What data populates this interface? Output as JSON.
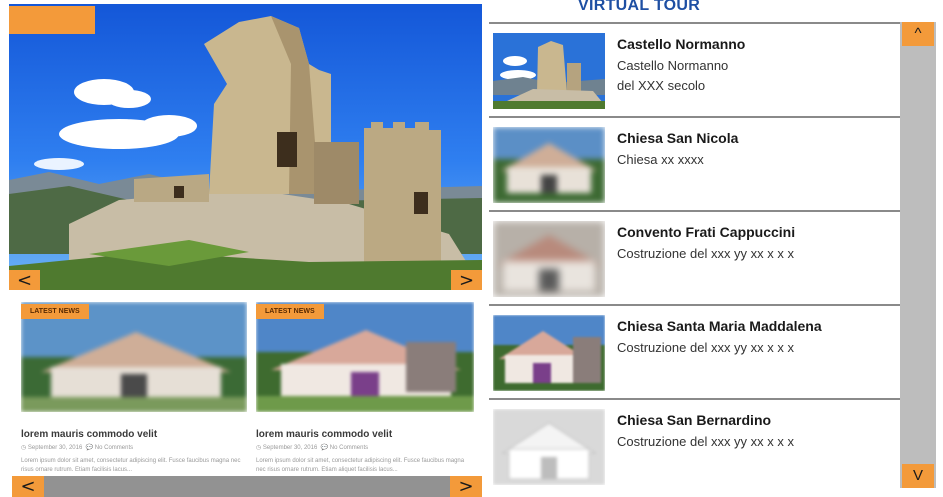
{
  "hero": {
    "prev_label": "<",
    "next_label": ">"
  },
  "news": {
    "cards": [
      {
        "tag": "LATEST NEWS",
        "title": "lorem mauris commodo velit",
        "date": "September 30, 2016",
        "comments": "No Comments",
        "excerpt": "Lorem ipsum dolor sit amet, consectetur adipiscing elit. Fusce faucibus magna nec risus ornare rutrum. Etiam facilisis lacus..."
      },
      {
        "tag": "LATEST NEWS",
        "title": "lorem mauris commodo velit",
        "date": "September 30, 2016",
        "comments": "No Comments",
        "excerpt": "Lorem ipsum dolor sit amet, consectetur adipiscing elit. Fusce faucibus magna nec risus ornare rutrum. Etiam aliquet facilisis lacus..."
      }
    ],
    "prev_label": "<",
    "next_label": ">"
  },
  "tour": {
    "title": "VIRTUAL TOUR",
    "items": [
      {
        "name": "Castello Normanno",
        "desc_line1": "Castello Normanno",
        "desc_line2": "del XXX secolo"
      },
      {
        "name": "Chiesa San Nicola",
        "desc_line1": "Chiesa xx  xxxx",
        "desc_line2": ""
      },
      {
        "name": "Convento Frati Cappuccini",
        "desc_line1": "Costruzione del xxx yy  xx   x  x  x",
        "desc_line2": ""
      },
      {
        "name": "Chiesa Santa Maria Maddalena",
        "desc_line1": "Costruzione del xxx yy  xx   x  x  x",
        "desc_line2": ""
      },
      {
        "name": "Chiesa San Bernardino",
        "desc_line1": "Costruzione del xxx yy  xx   x  x  x",
        "desc_line2": ""
      }
    ],
    "scroll_up_label": "^",
    "scroll_down_label": "V"
  },
  "colors": {
    "accent": "#f39a3a",
    "title_blue": "#1e4fa3",
    "scrollbar": "#bdbdbd"
  }
}
